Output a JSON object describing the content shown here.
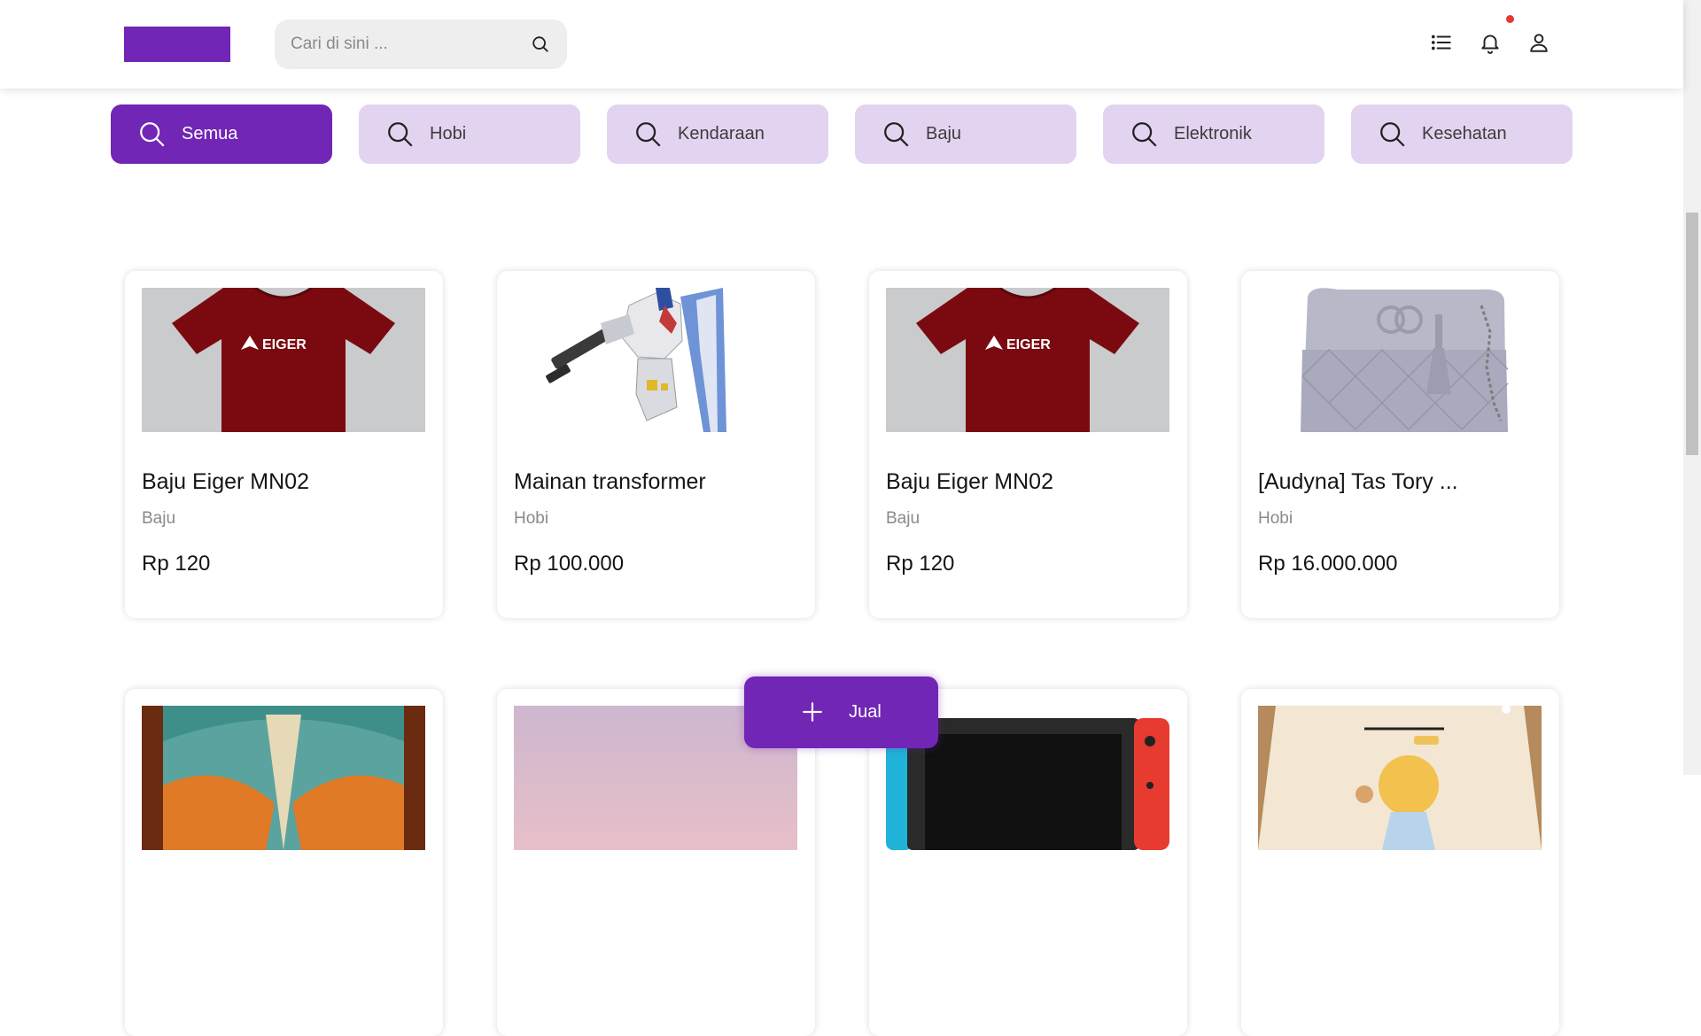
{
  "header": {
    "search_placeholder": "Cari di sini ...",
    "icons": [
      "list-icon",
      "bell-icon",
      "user-icon"
    ],
    "has_notification": true
  },
  "categories": [
    {
      "label": "Semua",
      "active": true
    },
    {
      "label": "Hobi",
      "active": false
    },
    {
      "label": "Kendaraan",
      "active": false
    },
    {
      "label": "Baju",
      "active": false
    },
    {
      "label": "Elektronik",
      "active": false
    },
    {
      "label": "Kesehatan",
      "active": false
    }
  ],
  "products": [
    {
      "name": "Baju Eiger MN02",
      "category": "Baju",
      "price": "Rp 120",
      "image": "red-tshirt"
    },
    {
      "name": "Mainan transformer",
      "category": "Hobi",
      "price": "Rp 100.000",
      "image": "robot-figure"
    },
    {
      "name": "Baju Eiger MN02",
      "category": "Baju",
      "price": "Rp 120",
      "image": "red-tshirt"
    },
    {
      "name": "[Audyna] Tas Tory ...",
      "category": "Hobi",
      "price": "Rp 16.000.000",
      "image": "grey-handbag"
    }
  ],
  "products_row2_images": [
    "abstract-painting",
    "pink-sky",
    "game-console",
    "cartoon-sweater"
  ],
  "printed_logo_text": "EIGER",
  "sell_button": {
    "label": "Jual",
    "icon": "plus-icon"
  },
  "colors": {
    "brand": "#7126b5",
    "category_bg": "#e2d4f0",
    "notification": "#e53935"
  }
}
